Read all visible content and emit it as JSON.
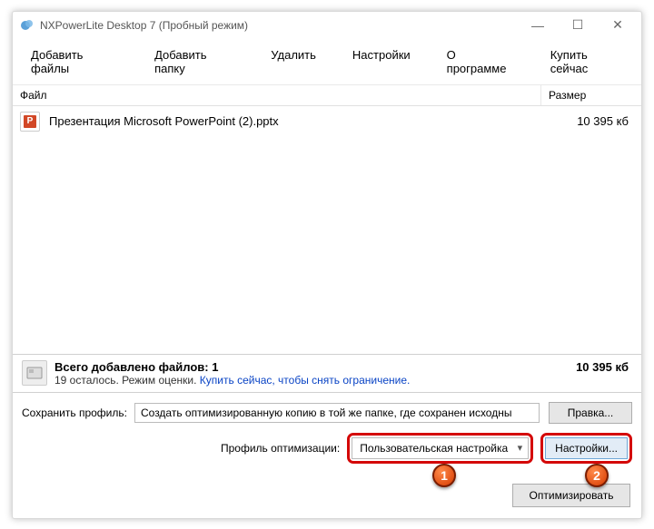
{
  "window": {
    "title": "NXPowerLite Desktop 7 (Пробный режим)"
  },
  "menu": {
    "add_files": "Добавить файлы",
    "add_folder": "Добавить папку",
    "delete": "Удалить",
    "settings": "Настройки",
    "about": "О программе",
    "buy_now": "Купить сейчас"
  },
  "columns": {
    "file": "Файл",
    "size": "Размер"
  },
  "files": [
    {
      "name": "Презентация Microsoft PowerPoint (2).pptx",
      "size": "10 395 кб"
    }
  ],
  "summary": {
    "total_label": "Всего добавлено файлов: 1",
    "total_size": "10 395 кб",
    "remaining_text": "19 осталось. Режим оценки. ",
    "buy_link": "Купить сейчас, чтобы снять ограничение."
  },
  "save_profile": {
    "label": "Сохранить профиль:",
    "value": "Создать оптимизированную копию в той же папке, где сохранен исходны",
    "edit_btn": "Правка..."
  },
  "opt_profile": {
    "label": "Профиль оптимизации:",
    "selected": "Пользовательская настройка",
    "settings_btn": "Настройки..."
  },
  "footer": {
    "optimize_btn": "Оптимизировать"
  },
  "badges": {
    "one": "1",
    "two": "2"
  }
}
